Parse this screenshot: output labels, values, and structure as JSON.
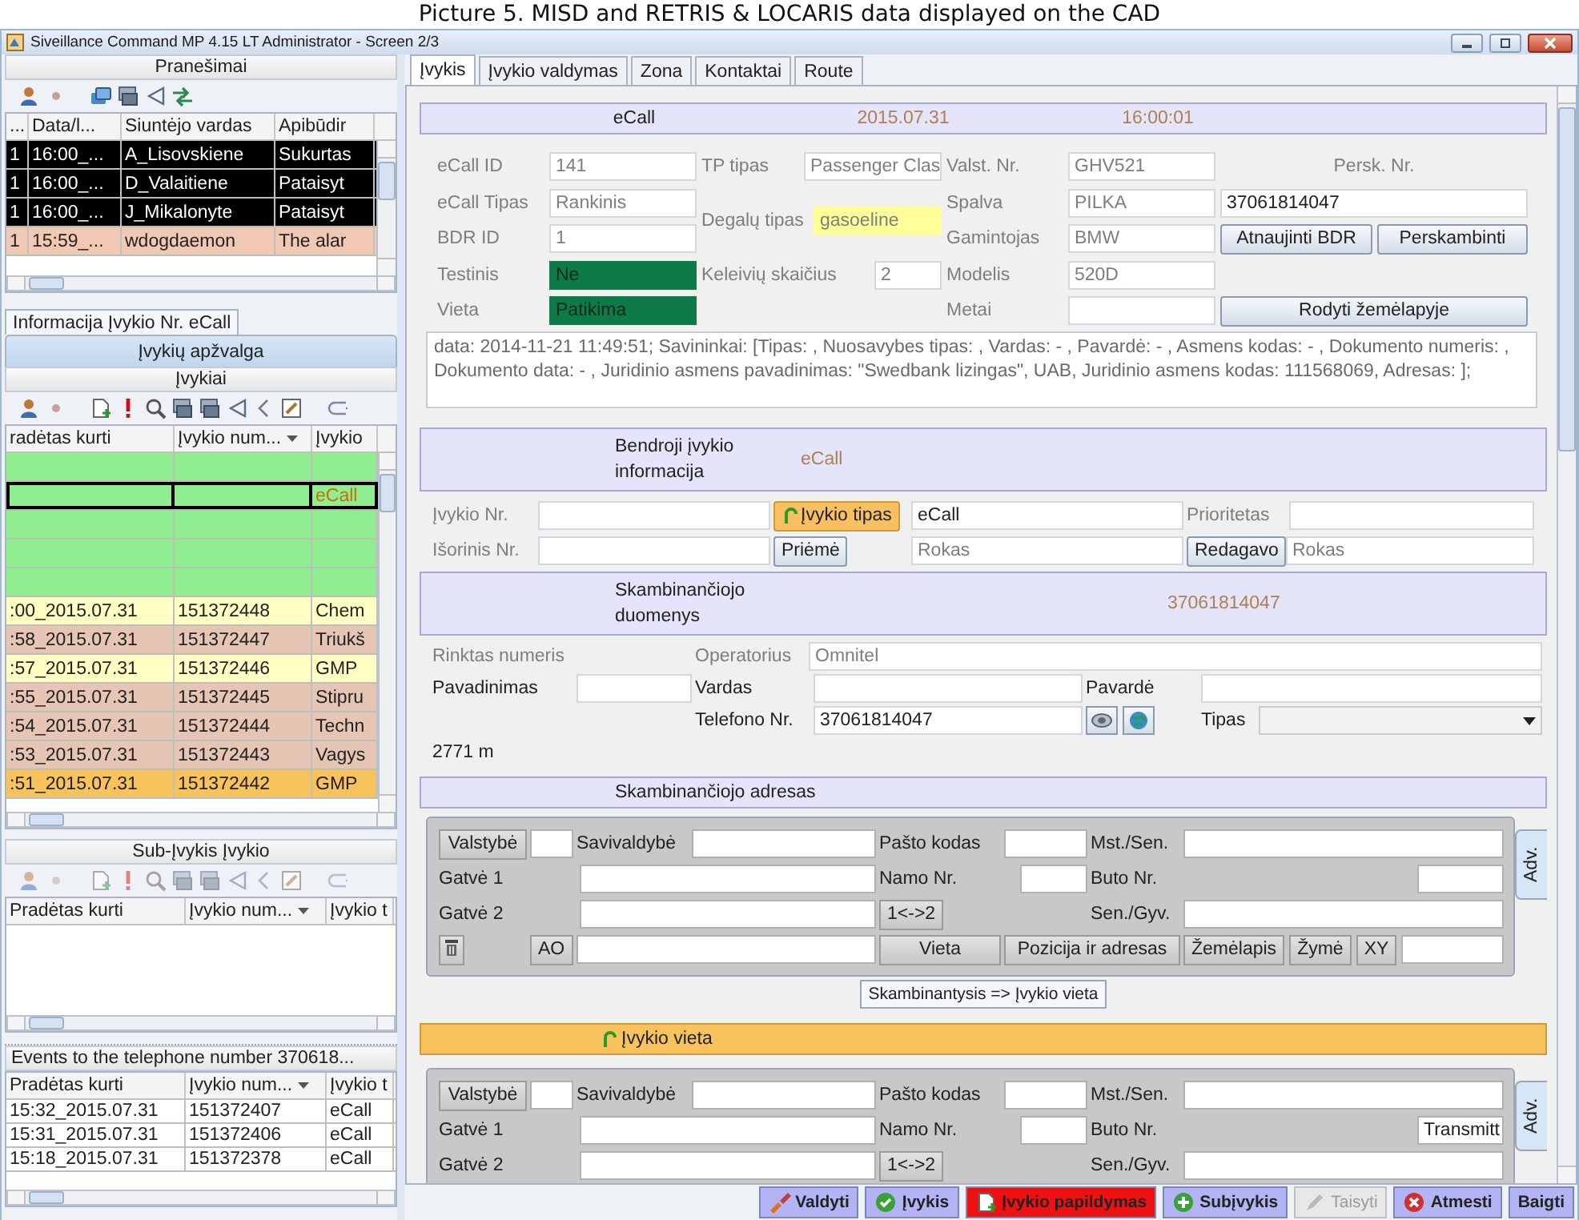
{
  "caption": "Picture 5. MISD and RETRIS & LOCARIS data displayed on the CAD",
  "window": {
    "title": "Siveillance Command MP 4.15 LT Administrator - Screen 2/3"
  },
  "messages": {
    "title": "Pranešimai",
    "columns": [
      "...",
      "Data/l...",
      "Siuntėjo vardas",
      "Apibūdir"
    ],
    "rows": [
      {
        "cells": [
          "1",
          "16:00_...",
          "A_Lisovskiene",
          "Sukurtas"
        ],
        "color": "#000000"
      },
      {
        "cells": [
          "1",
          "16:00_...",
          "D_Valaitiene",
          "Pataisyt"
        ],
        "color": "#000000"
      },
      {
        "cells": [
          "1",
          "16:00_...",
          "J_Mikalonyte",
          "Pataisyt"
        ],
        "color": "#000000"
      },
      {
        "cells": [
          "1",
          "15:59_...",
          "wdogdaemon",
          "The alar"
        ],
        "color": "#f0c8b4"
      }
    ]
  },
  "left_tabs": [
    {
      "label": "Informacija Įvykio Nr. eCall",
      "selected": false
    },
    {
      "label": "Įvykių apžvalga",
      "selected": true
    }
  ],
  "incidents": {
    "title": "Įvykiai",
    "columns": [
      "radėtas kurti",
      "Įvykio num...",
      "Įvykio"
    ],
    "rows": [
      {
        "color": "#90ee90",
        "selected": false
      },
      {
        "cells": [
          null,
          null,
          "eCall"
        ],
        "color": "#90ee90",
        "selected": true
      },
      {
        "color": "#90ee90",
        "selected": false
      },
      {
        "color": "#90ee90",
        "selected": false
      },
      {
        "color": "#90ee90",
        "selected": false
      },
      {
        "cells": [
          ":00_2015.07.31",
          "151372448",
          "Chem"
        ],
        "color": "#ffffc4",
        "selected": false
      },
      {
        "cells": [
          ":58_2015.07.31",
          "151372447",
          "Triukš"
        ],
        "color": "#e6c5b5",
        "selected": false
      },
      {
        "cells": [
          ":57_2015.07.31",
          "151372446",
          "GMP"
        ],
        "color": "#ffffc4",
        "selected": false
      },
      {
        "cells": [
          ":55_2015.07.31",
          "151372445",
          "Stipru"
        ],
        "color": "#e6c5b5",
        "selected": false
      },
      {
        "cells": [
          ":54_2015.07.31",
          "151372444",
          "Techn"
        ],
        "color": "#e6c5b5",
        "selected": false
      },
      {
        "cells": [
          ":53_2015.07.31",
          "151372443",
          "Vagys"
        ],
        "color": "#e6c5b5",
        "selected": false
      },
      {
        "cells": [
          ":51_2015.07.31",
          "151372442",
          "GMP"
        ],
        "color": "#f8c25c",
        "selected": false
      }
    ]
  },
  "sub_incidents": {
    "title": "Sub-Įvykis Įvykio",
    "columns": [
      "Pradėtas kurti",
      "Įvykio num...",
      "Įvykio t"
    ]
  },
  "phone_events": {
    "title": "Events to the telephone number 370618...",
    "columns": [
      "Pradėtas kurti",
      "Įvykio num...",
      "Įvykio t"
    ],
    "rows": [
      {
        "cells": [
          "15:32_2015.07.31",
          "151372407",
          "eCall"
        ]
      },
      {
        "cells": [
          "15:31_2015.07.31",
          "151372406",
          "eCall"
        ]
      },
      {
        "cells": [
          "15:18_2015.07.31",
          "151372378",
          "eCall"
        ]
      }
    ]
  },
  "tabs": [
    {
      "label": "Įvykis",
      "selected": true
    },
    {
      "label": "Įvykio valdymas",
      "selected": false
    },
    {
      "label": "Zona",
      "selected": false
    },
    {
      "label": "Kontaktai",
      "selected": false
    },
    {
      "label": "Route",
      "selected": false
    }
  ],
  "ecall": {
    "header": [
      "eCall",
      "2015.07.31",
      "16:00:01"
    ],
    "items": [
      {
        "kind": "field",
        "label": "eCall ID",
        "value": "141",
        "disabled": true
      },
      {
        "kind": "field",
        "label": "TP tipas",
        "value": "Passenger Clas",
        "disabled": true
      },
      {
        "kind": "field",
        "label": "Valst. Nr.",
        "value": "GHV521",
        "disabled": true
      },
      {
        "kind": "label",
        "label": "Persk. Nr.",
        "disabled": true
      },
      {
        "kind": "field",
        "label": "eCall Tipas",
        "value": "Rankinis",
        "disabled": true
      },
      {
        "kind": "field",
        "label": "Degalų tipas",
        "value": "gasoeline",
        "disabled": true,
        "color": "#ffff99"
      },
      {
        "kind": "field",
        "label": "Spalva",
        "value": "PILKA",
        "disabled": true
      },
      {
        "kind": "field",
        "value": "37061814047",
        "disabled": false
      },
      {
        "kind": "field",
        "label": "BDR ID",
        "value": "1",
        "disabled": true
      },
      {
        "kind": "field",
        "label": "Gamintojas",
        "value": "BMW",
        "disabled": true
      },
      {
        "kind": "button",
        "label": "Atnaujinti BDR",
        "disabled": false
      },
      {
        "kind": "button",
        "label": "Perskambinti",
        "disabled": false
      },
      {
        "kind": "field",
        "label": "Testinis",
        "value": "Ne",
        "disabled": true,
        "color": "#0e7a48"
      },
      {
        "kind": "field",
        "label": "Keleivių skaičius",
        "value": "2",
        "disabled": true
      },
      {
        "kind": "field",
        "label": "Modelis",
        "value": "520D",
        "disabled": true
      },
      {
        "kind": "field",
        "label": "Vieta",
        "value": "Patikima",
        "disabled": true,
        "color": "#0e7a48"
      },
      {
        "kind": "field",
        "label": "Metai",
        "disabled": true
      },
      {
        "kind": "button",
        "label": "Rodyti žemėlapyje",
        "disabled": false
      }
    ],
    "note": "data: 2014-11-21 11:49:51; Savininkai: [Tipas: , Nuosavybes tipas: , Vardas: - , Pavardė: - , Asmens kodas: - , Dokumento numeris: , Dokumento data: - , Juridinio asmens pavadinimas: \"Swedbank lizingas\", UAB, Juridinio asmens kodas: 111568069, Adresas: ];"
  },
  "general": {
    "title": "Bendroji įvykio informacija",
    "value": "eCall",
    "items": [
      {
        "kind": "field",
        "label": "Įvykio Nr.",
        "disabled": true
      },
      {
        "kind": "accent-button",
        "label": "Įvykio tipas",
        "disabled": false
      },
      {
        "kind": "field",
        "value": "eCall",
        "disabled": false
      },
      {
        "kind": "field",
        "label": "Prioritetas",
        "disabled": true
      },
      {
        "kind": "field",
        "label": "Išorinis Nr.",
        "disabled": true
      },
      {
        "kind": "button",
        "label": "Priėmė",
        "disabled": false
      },
      {
        "kind": "field",
        "value": "Rokas",
        "disabled": true
      },
      {
        "kind": "button",
        "label": "Redagavo",
        "disabled": false
      },
      {
        "kind": "field",
        "value": "Rokas",
        "disabled": true
      }
    ]
  },
  "caller": {
    "title": "Skambinančiojo duomenys",
    "value": "37061814047",
    "items": [
      {
        "kind": "label",
        "label": "Rinktas numeris",
        "disabled": true
      },
      {
        "kind": "field",
        "label": "Operatorius",
        "value": "Omnitel",
        "disabled": true
      },
      {
        "kind": "field",
        "label": "Pavadinimas",
        "disabled": false
      },
      {
        "kind": "field",
        "label": "Vardas",
        "disabled": false
      },
      {
        "kind": "field",
        "label": "Pavardė",
        "disabled": false
      },
      {
        "kind": "field",
        "label": "Telefono Nr.",
        "value": "37061814047",
        "disabled": false
      },
      {
        "kind": "select",
        "label": "Tipas",
        "disabled": false
      },
      {
        "kind": "text",
        "label": "2771 m",
        "disabled": false
      }
    ]
  },
  "caller_address": {
    "title": "Skambinančiojo adresas",
    "side_tab": "Adv.",
    "items": [
      {
        "kind": "button",
        "label": "Valstybė"
      },
      {
        "kind": "field"
      },
      {
        "kind": "field",
        "label": "Savivaldybė"
      },
      {
        "kind": "field",
        "label": "Pašto kodas"
      },
      {
        "kind": "field",
        "label": "Mst./Sen."
      },
      {
        "kind": "field",
        "label": "Gatvė 1"
      },
      {
        "kind": "field",
        "label": "Namo Nr."
      },
      {
        "kind": "field",
        "label": "Buto Nr."
      },
      {
        "kind": "field",
        "label": "Gatvė 2"
      },
      {
        "kind": "button",
        "label": "1<->2"
      },
      {
        "kind": "field",
        "label": "Sen./Gyv."
      },
      {
        "kind": "button",
        "label": "AO"
      },
      {
        "kind": "field"
      },
      {
        "kind": "button",
        "label": "Vieta"
      },
      {
        "kind": "button",
        "label": "Pozicija ir adresas"
      },
      {
        "kind": "button",
        "label": "Žemėlapis"
      },
      {
        "kind": "button",
        "label": "Žymė"
      },
      {
        "kind": "button",
        "label": "XY"
      },
      {
        "kind": "field"
      }
    ]
  },
  "copy_button": "Skambinantysis => Įvykio vieta",
  "incident_location": {
    "title": "Įvykio vieta",
    "side_tab": "Adv.",
    "items": [
      {
        "kind": "button",
        "label": "Valstybė"
      },
      {
        "kind": "field"
      },
      {
        "kind": "field",
        "label": "Savivaldybė"
      },
      {
        "kind": "field",
        "label": "Pašto kodas"
      },
      {
        "kind": "field",
        "label": "Mst./Sen."
      },
      {
        "kind": "field",
        "label": "Gatvė 1"
      },
      {
        "kind": "field",
        "label": "Namo Nr."
      },
      {
        "kind": "field",
        "label": "Buto Nr.",
        "value": "Transmitt"
      },
      {
        "kind": "field",
        "label": "Gatvė 2"
      },
      {
        "kind": "button",
        "label": "1<->2"
      },
      {
        "kind": "field",
        "label": "Sen./Gyv."
      }
    ]
  },
  "actions": [
    {
      "label": "Valdyti",
      "color": "#b4b4f4",
      "disabled": false
    },
    {
      "label": "Įvykis",
      "color": "#b4b4f4",
      "disabled": false
    },
    {
      "label": "Įvykio papildymas",
      "color": "#ee1111",
      "disabled": false
    },
    {
      "label": "Subįvykis",
      "color": "#b4b4f4",
      "disabled": false
    },
    {
      "label": "Taisyti",
      "color": "#e8e8e8",
      "disabled": true
    },
    {
      "label": "Atmesti",
      "color": "#b4b4f4",
      "disabled": false
    },
    {
      "label": "Baigti",
      "color": "#b4b4f4",
      "disabled": false
    }
  ]
}
